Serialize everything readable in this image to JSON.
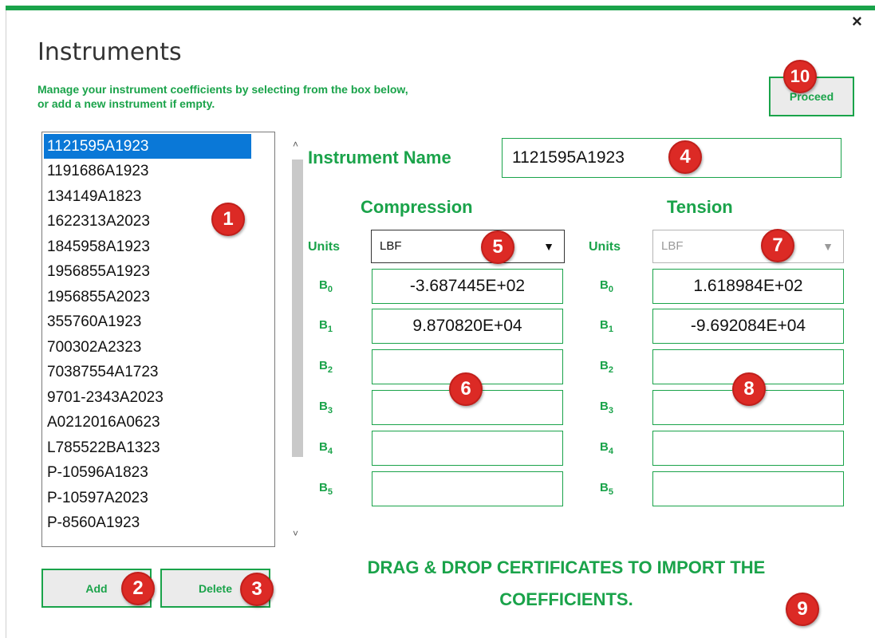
{
  "window": {
    "close_symbol": "×"
  },
  "header": {
    "title": "Instruments",
    "subtitle_line1": "Manage your instrument coefficients by selecting from the box below,",
    "subtitle_line2": "or add a new instrument if empty.",
    "proceed_label": "Proceed"
  },
  "instrument_list": {
    "selected": "1121595A1923",
    "items": [
      "1121595A1923",
      "1191686A1923",
      "134149A1823",
      "1622313A2023",
      "1845958A1923",
      "1956855A1923",
      "1956855A2023",
      "355760A1923",
      "700302A2323",
      "70387554A1723",
      "9701-2343A2023",
      "A0212016A0623",
      "L785522BA1323",
      "P-10596A1823",
      "P-10597A2023",
      "P-8560A1923"
    ]
  },
  "buttons": {
    "add": "Add",
    "delete": "Delete"
  },
  "instrument_name": {
    "label": "Instrument Name",
    "value": "1121595A1923"
  },
  "compression": {
    "title": "Compression",
    "units_label": "Units",
    "units_value": "LBF",
    "coefficients": [
      {
        "label": "B",
        "sub": "0",
        "value": "-3.687445E+02"
      },
      {
        "label": "B",
        "sub": "1",
        "value": "9.870820E+04"
      },
      {
        "label": "B",
        "sub": "2",
        "value": ""
      },
      {
        "label": "B",
        "sub": "3",
        "value": ""
      },
      {
        "label": "B",
        "sub": "4",
        "value": ""
      },
      {
        "label": "B",
        "sub": "5",
        "value": ""
      }
    ]
  },
  "tension": {
    "title": "Tension",
    "units_label": "Units",
    "units_value": "LBF",
    "coefficients": [
      {
        "label": "B",
        "sub": "0",
        "value": "1.618984E+02"
      },
      {
        "label": "B",
        "sub": "1",
        "value": "-9.692084E+04"
      },
      {
        "label": "B",
        "sub": "2",
        "value": ""
      },
      {
        "label": "B",
        "sub": "3",
        "value": ""
      },
      {
        "label": "B",
        "sub": "4",
        "value": ""
      },
      {
        "label": "B",
        "sub": "5",
        "value": ""
      }
    ]
  },
  "drag_drop": {
    "line1": "DRAG & DROP CERTIFICATES TO IMPORT THE",
    "line2": "COEFFICIENTS."
  },
  "annotations": [
    "1",
    "2",
    "3",
    "4",
    "5",
    "6",
    "7",
    "8",
    "9",
    "10"
  ],
  "colors": {
    "accent": "#1aa34a",
    "selection": "#0a78d7",
    "badge": "#dc2a25"
  },
  "icons": {
    "close": "close-icon",
    "dropdown": "chevron-down-icon",
    "scroll_up": "scroll-up-arrow-icon",
    "scroll_down": "scroll-down-arrow-icon"
  }
}
